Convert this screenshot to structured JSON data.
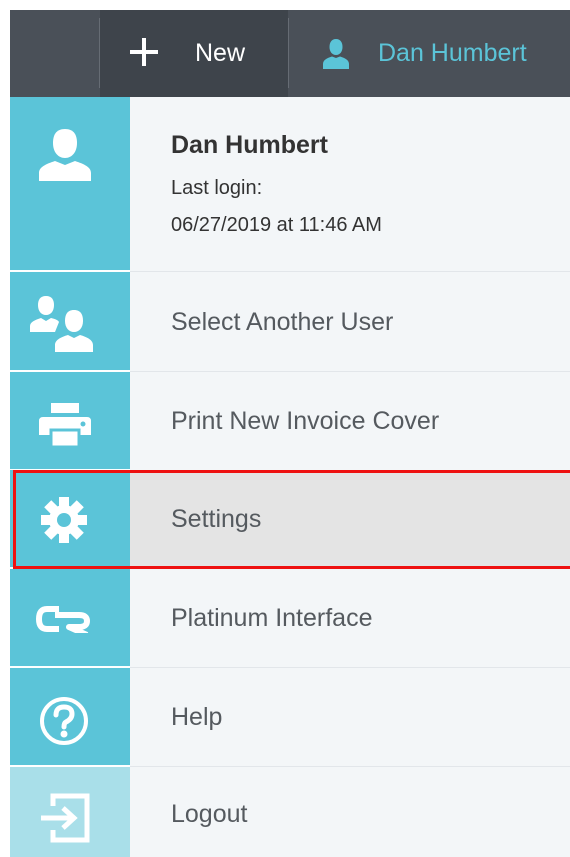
{
  "topbar": {
    "new_label": "New",
    "user_label": "Dan Humbert"
  },
  "profile": {
    "name": "Dan Humbert",
    "last_login_label": "Last login:",
    "last_login_value": "06/27/2019 at 11:46 AM"
  },
  "menu": {
    "items": [
      {
        "label": "Select Another User",
        "icon": "users-icon"
      },
      {
        "label": "Print New Invoice Cover",
        "icon": "printer-icon"
      },
      {
        "label": "Settings",
        "icon": "gear-icon",
        "selected": true
      },
      {
        "label": "Platinum Interface",
        "icon": "cr-logo-icon"
      },
      {
        "label": "Help",
        "icon": "help-icon"
      },
      {
        "label": "Logout",
        "icon": "logout-icon"
      }
    ]
  },
  "colors": {
    "accent": "#5bc4d8",
    "topbar": "#4a5058",
    "highlight_border": "#ee1111",
    "selected_bg": "#e4e4e4"
  }
}
